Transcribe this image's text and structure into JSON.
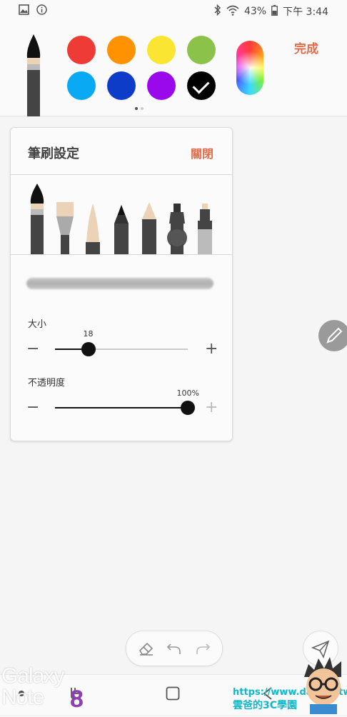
{
  "status_bar": {
    "battery": "43%",
    "time": "下午 3:44"
  },
  "toolbar": {
    "done_label": "完成",
    "swatches": [
      "#ee3b36",
      "#ff9200",
      "#fae632",
      "#8bc34a",
      "#0aa9f4",
      "#0d3cc8",
      "#9a09ec",
      "#000000"
    ],
    "selected_swatch": 7,
    "page_indicator": {
      "count": 2,
      "active": 0
    }
  },
  "brush_panel": {
    "title": "筆刷設定",
    "close_label": "關閉",
    "brushes": [
      "fountain-pen",
      "calligraphy-brush",
      "soft-brush",
      "pencil",
      "pen",
      "marker",
      "highlighter"
    ],
    "selected_brush": 0,
    "size": {
      "label": "大小",
      "value_label": "18",
      "value_fraction": 0.25,
      "minus": "−",
      "plus": "+"
    },
    "opacity": {
      "label": "不透明度",
      "value_label": "100%",
      "value_fraction": 1.0,
      "minus": "−",
      "plus": "+"
    }
  },
  "watermark": {
    "galaxy": "Galaxy",
    "note": "Note",
    "model": "8",
    "url": "https://www.dacota.tw",
    "site_name": "雲爸的3C學園"
  }
}
